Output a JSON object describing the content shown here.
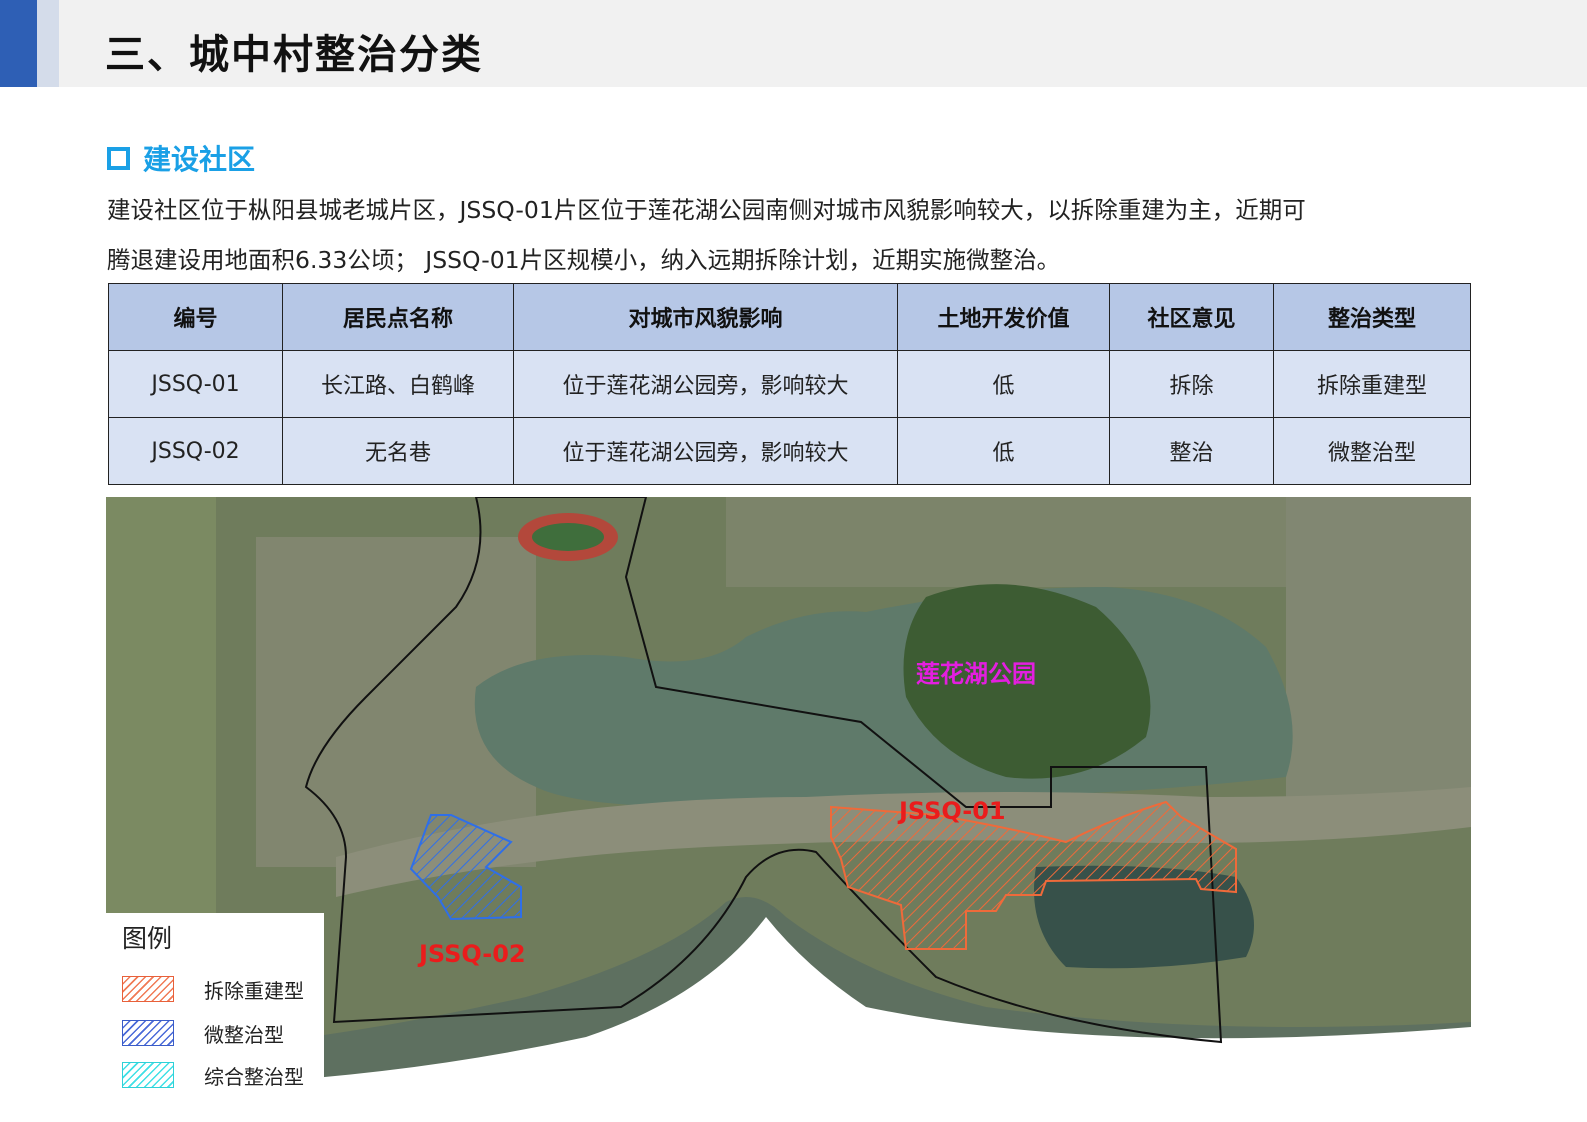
{
  "header": {
    "title": "三、城中村整治分类"
  },
  "section": {
    "heading": "建设社区"
  },
  "description": {
    "line1": "建设社区位于枞阳县城老城片区，JSSQ-01片区位于莲花湖公园南侧对城市风貌影响较大，以拆除重建为主，近期可",
    "line2": "腾退建设用地面积6.33公顷； JSSQ-01片区规模小，纳入远期拆除计划，近期实施微整治。"
  },
  "table": {
    "headers": [
      "编号",
      "居民点名称",
      "对城市风貌影响",
      "土地开发价值",
      "社区意见",
      "整治类型"
    ],
    "rows": [
      [
        "JSSQ-01",
        "长江路、白鹤峰",
        "位于莲花湖公园旁，影响较大",
        "低",
        "拆除",
        "拆除重建型"
      ],
      [
        "JSSQ-02",
        "无名巷",
        "位于莲花湖公园旁，影响较大",
        "低",
        "整治",
        "微整治型"
      ]
    ]
  },
  "map": {
    "park_label": "莲花湖公园",
    "zone_labels": {
      "a": "JSSQ-01",
      "b": "JSSQ-02"
    },
    "zone_colors": {
      "demolish_rebuild": "#ef6a3a",
      "micro_renovation": "#2f6fe8",
      "comprehensive": "#3fe0e6"
    },
    "legend": {
      "title": "图例",
      "items": [
        "拆除重建型",
        "微整治型",
        "综合整治型"
      ]
    }
  }
}
